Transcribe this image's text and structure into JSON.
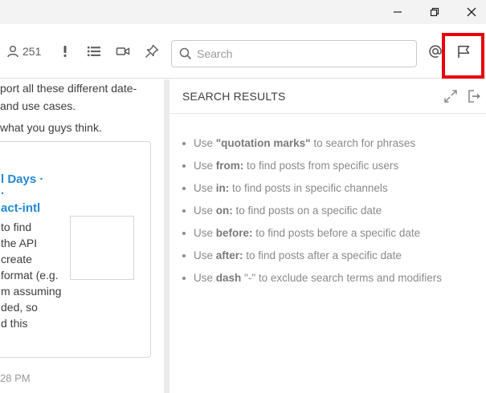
{
  "toolbar": {
    "member_count": "251",
    "search_placeholder": "Search"
  },
  "left_pane": {
    "line1": "port all these different date-",
    "line2": "and use cases.",
    "line3": "what you guys think.",
    "card": {
      "link_line1": "l Days ·",
      "link_line2": "·",
      "link_line3": "act-intl",
      "body_lines": [
        "to find",
        "the API",
        "create",
        "format (e.g.",
        "m assuming",
        "ded, so",
        "d this"
      ]
    },
    "timestamp": "28 PM"
  },
  "rhs": {
    "title": "SEARCH RESULTS",
    "hints": [
      {
        "pre": "Use ",
        "term": "\"quotation marks\"",
        "post": " to search for phrases"
      },
      {
        "pre": "Use ",
        "term": "from:",
        "post": " to find posts from specific users"
      },
      {
        "pre": "Use ",
        "term": "in:",
        "post": " to find posts in specific channels"
      },
      {
        "pre": "Use ",
        "term": "on:",
        "post": " to find posts on a specific date"
      },
      {
        "pre": "Use ",
        "term": "before:",
        "post": " to find posts before a specific date"
      },
      {
        "pre": "Use ",
        "term": "after:",
        "post": " to find posts after a specific date"
      },
      {
        "pre": "Use ",
        "term": "dash",
        "post": " \"-\" to exclude search terms and modifiers"
      }
    ]
  },
  "colors": {
    "highlight": "#e8000b",
    "link": "#2389d7"
  }
}
